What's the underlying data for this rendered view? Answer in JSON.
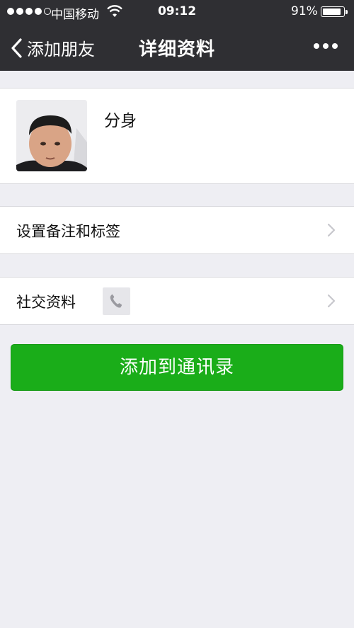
{
  "status_bar": {
    "carrier": "中国移动",
    "time": "09:12",
    "battery_percent": "91%",
    "battery_level": 0.91,
    "signal_bars_filled": 4,
    "signal_bars_total": 5
  },
  "nav": {
    "back_label": "添加朋友",
    "title": "详细资料",
    "more_icon": "more-dots-icon"
  },
  "profile": {
    "name": "分身",
    "avatar_icon": "profile-photo"
  },
  "rows": {
    "remark_label": "设置备注和标签",
    "social_label": "社交资料",
    "social_icon": "phone-icon"
  },
  "actions": {
    "add_contact_label": "添加到通讯录"
  },
  "colors": {
    "nav_bg": "#2f2f33",
    "page_bg": "#eeeef3",
    "primary_green": "#1aad19"
  }
}
